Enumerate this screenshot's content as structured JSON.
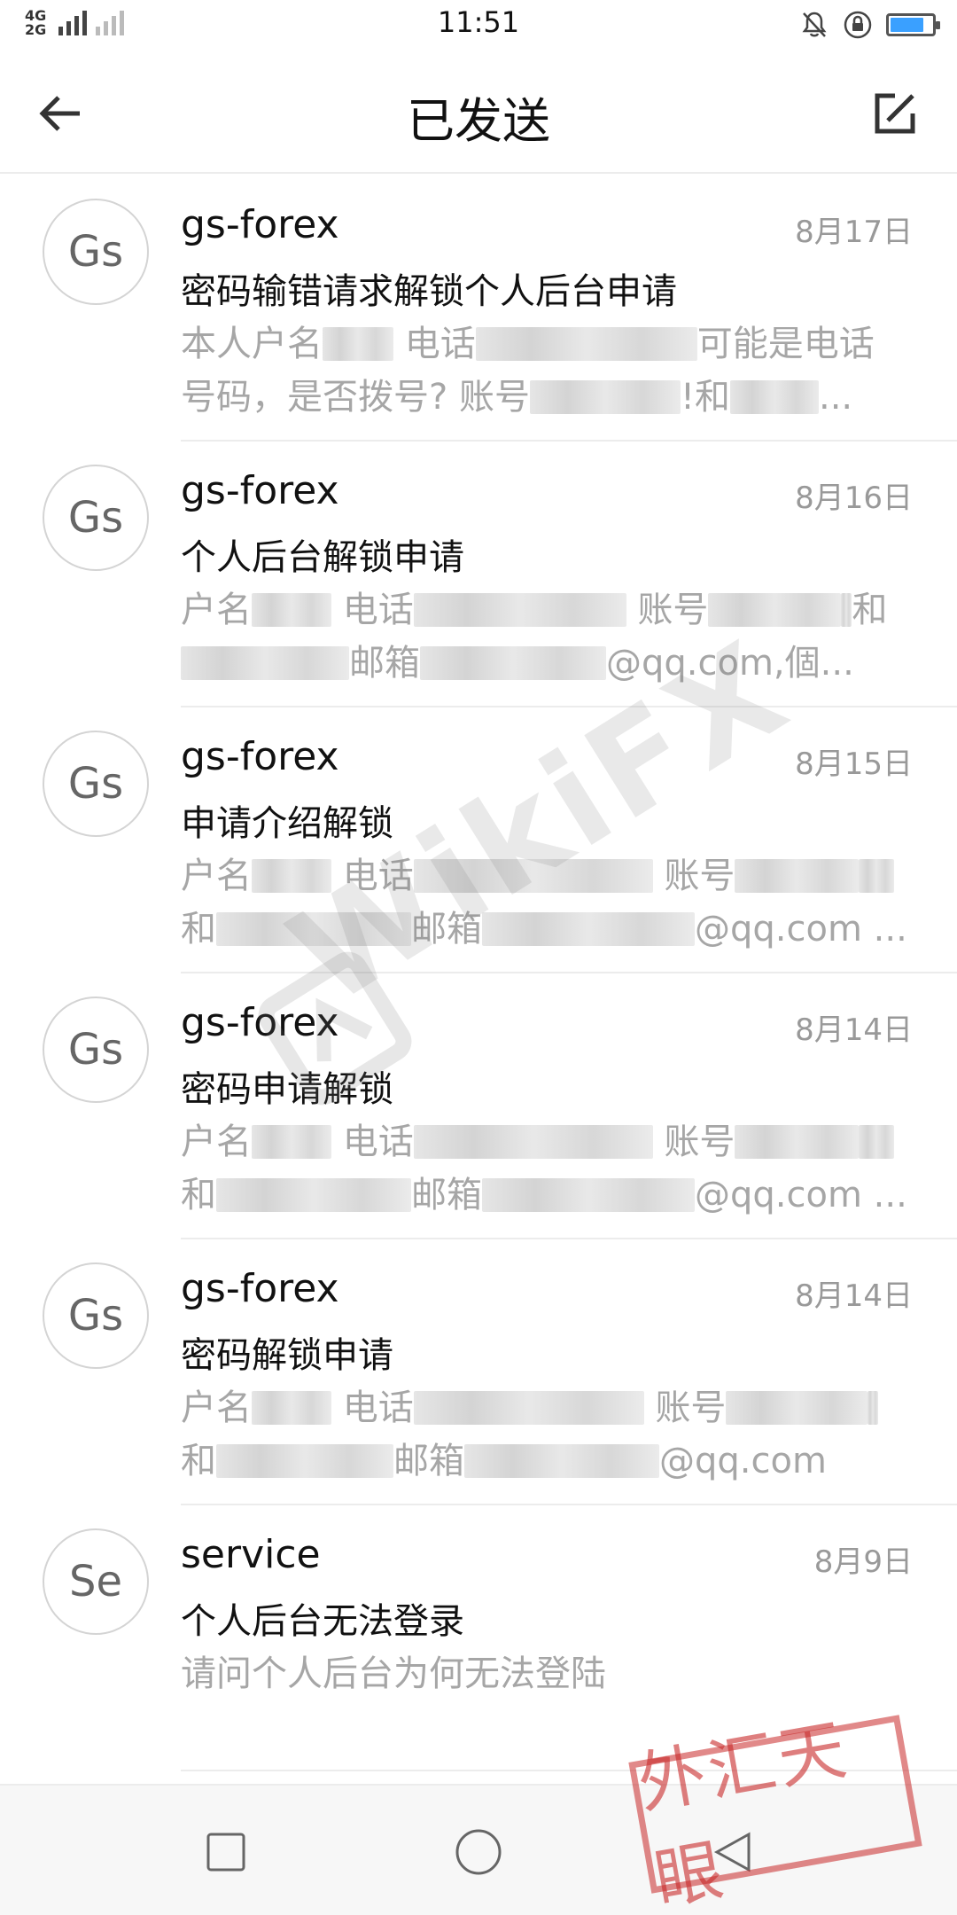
{
  "status_bar": {
    "network_top": "4G",
    "network_bottom": "2G",
    "time": "11:51"
  },
  "header": {
    "title": "已发送",
    "back_icon": "arrow-left-icon",
    "compose_icon": "compose-icon"
  },
  "mails": [
    {
      "avatar": "Gs",
      "sender": "gs-forex",
      "date": "8月17日",
      "subject": "密码输错请求解锁个人后台申请",
      "preview_1": "本人户名",
      "preview_2": "电话",
      "preview_3": "可能是电话号码，是否拨号? 账号",
      "preview_4": "!和",
      "preview_5": "..."
    },
    {
      "avatar": "Gs",
      "sender": "gs-forex",
      "date": "8月16日",
      "subject": "个人后台解锁申请",
      "preview_1": "户名",
      "preview_2": "电话",
      "preview_3": "账号",
      "preview_4": "和",
      "preview_5": "邮箱",
      "preview_6": "@qq.com,個..."
    },
    {
      "avatar": "Gs",
      "sender": "gs-forex",
      "date": "8月15日",
      "subject": "申请介绍解锁",
      "preview_1": "户名",
      "preview_2": "电话",
      "preview_3": "账号",
      "preview_4": "和",
      "preview_5": "邮箱",
      "preview_6": "@qq.com ..."
    },
    {
      "avatar": "Gs",
      "sender": "gs-forex",
      "date": "8月14日",
      "subject": "密码申请解锁",
      "preview_1": "户名",
      "preview_2": "电话",
      "preview_3": "账号",
      "preview_4": "和",
      "preview_5": "邮箱",
      "preview_6": "@qq.com ..."
    },
    {
      "avatar": "Gs",
      "sender": "gs-forex",
      "date": "8月14日",
      "subject": "密码解锁申请",
      "preview_1": "户名",
      "preview_2": "电话",
      "preview_3": "账号",
      "preview_4": "和",
      "preview_5": "邮箱",
      "preview_6": "@qq.com"
    },
    {
      "avatar": "Se",
      "sender": "service",
      "date": "8月9日",
      "subject": "个人后台无法登录",
      "preview_1": "请问个人后台为何无法登陆"
    }
  ],
  "watermark": "WikiFX",
  "stamp": "外汇天眼",
  "colors": {
    "battery": "#3aa0ff",
    "stamp": "#c82828"
  }
}
